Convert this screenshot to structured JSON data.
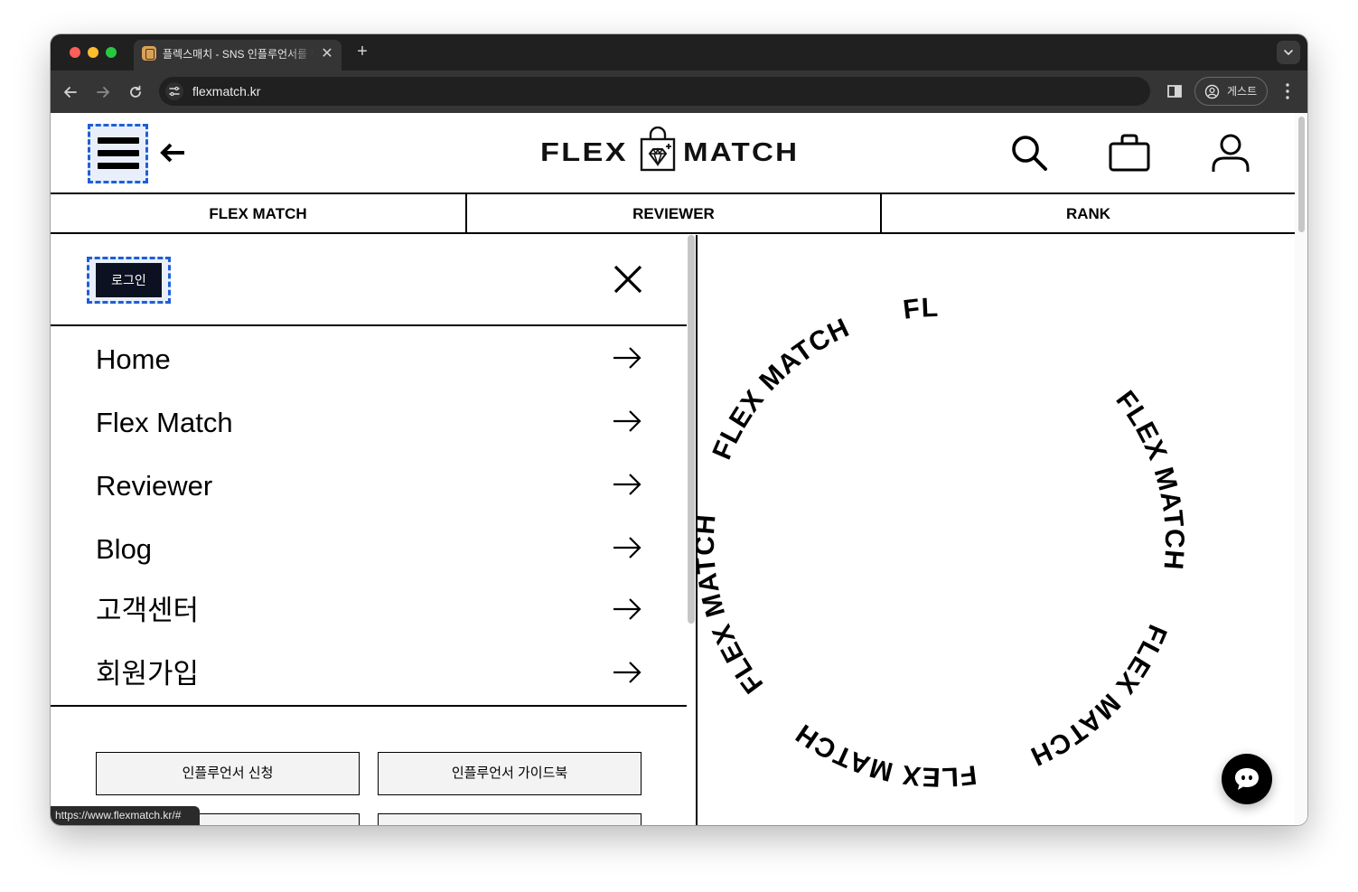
{
  "browser": {
    "tab_title": "플렉스매치 - SNS 인플루언서를 위",
    "tab_close": "✕",
    "new_tab": "+",
    "url": "flexmatch.kr",
    "profile_label": "게스트"
  },
  "header": {
    "logo_left": "FLEX",
    "logo_right": "MATCH",
    "icons": [
      "search-icon",
      "bag-icon",
      "user-icon"
    ]
  },
  "main_nav": [
    {
      "label": "FLEX MATCH"
    },
    {
      "label": "REVIEWER"
    },
    {
      "label": "RANK"
    }
  ],
  "drawer": {
    "login_label": "로그인",
    "menu": [
      {
        "label": "Home"
      },
      {
        "label": "Flex Match"
      },
      {
        "label": "Reviewer"
      },
      {
        "label": "Blog"
      },
      {
        "label": "고객센터"
      },
      {
        "label": "회원가입"
      }
    ],
    "buttons": [
      {
        "label": "인플루언서 신청"
      },
      {
        "label": "인플루언서 가이드북"
      }
    ]
  },
  "rotating_text": {
    "segments": [
      "FLEX MATCH",
      "FLEX MATCH",
      "FLEX MATCH",
      "FLEX MATCH",
      "FLEX MATCH",
      "FLEX MATCH"
    ]
  },
  "status_bar": {
    "url": "https://www.flexmatch.kr/#"
  },
  "colors": {
    "focus_outline": "#1f5fd6",
    "login_bg": "#0b1120",
    "chrome_dark": "#202020",
    "chrome_toolbar": "#353535"
  }
}
